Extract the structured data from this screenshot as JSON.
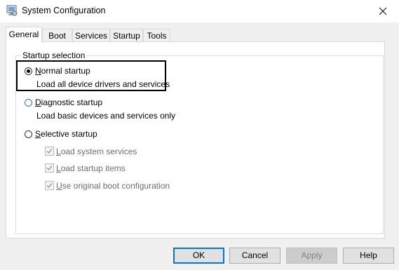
{
  "window": {
    "title": "System Configuration"
  },
  "tabs": [
    {
      "label": "General"
    },
    {
      "label": "Boot"
    },
    {
      "label": "Services"
    },
    {
      "label": "Startup"
    },
    {
      "label": "Tools"
    }
  ],
  "general": {
    "group_title": "Startup selection",
    "normal": {
      "label_first": "N",
      "label_rest": "ormal startup",
      "description": "Load all device drivers and services",
      "selected": true
    },
    "diagnostic": {
      "label_first": "D",
      "label_rest": "iagnostic startup",
      "description": "Load basic devices and services only",
      "selected": false
    },
    "selective": {
      "label_first": "S",
      "label_rest": "elective startup",
      "selected": false,
      "options": [
        {
          "label_first": "L",
          "label_rest": "oad system services",
          "checked": true
        },
        {
          "label_first": "L",
          "label_rest": "oad startup items",
          "checked": true
        },
        {
          "label_first": "U",
          "label_rest": "se original boot configuration",
          "checked": true
        }
      ]
    }
  },
  "buttons": {
    "ok": "OK",
    "cancel": "Cancel",
    "apply": "Apply",
    "help": "Help"
  }
}
